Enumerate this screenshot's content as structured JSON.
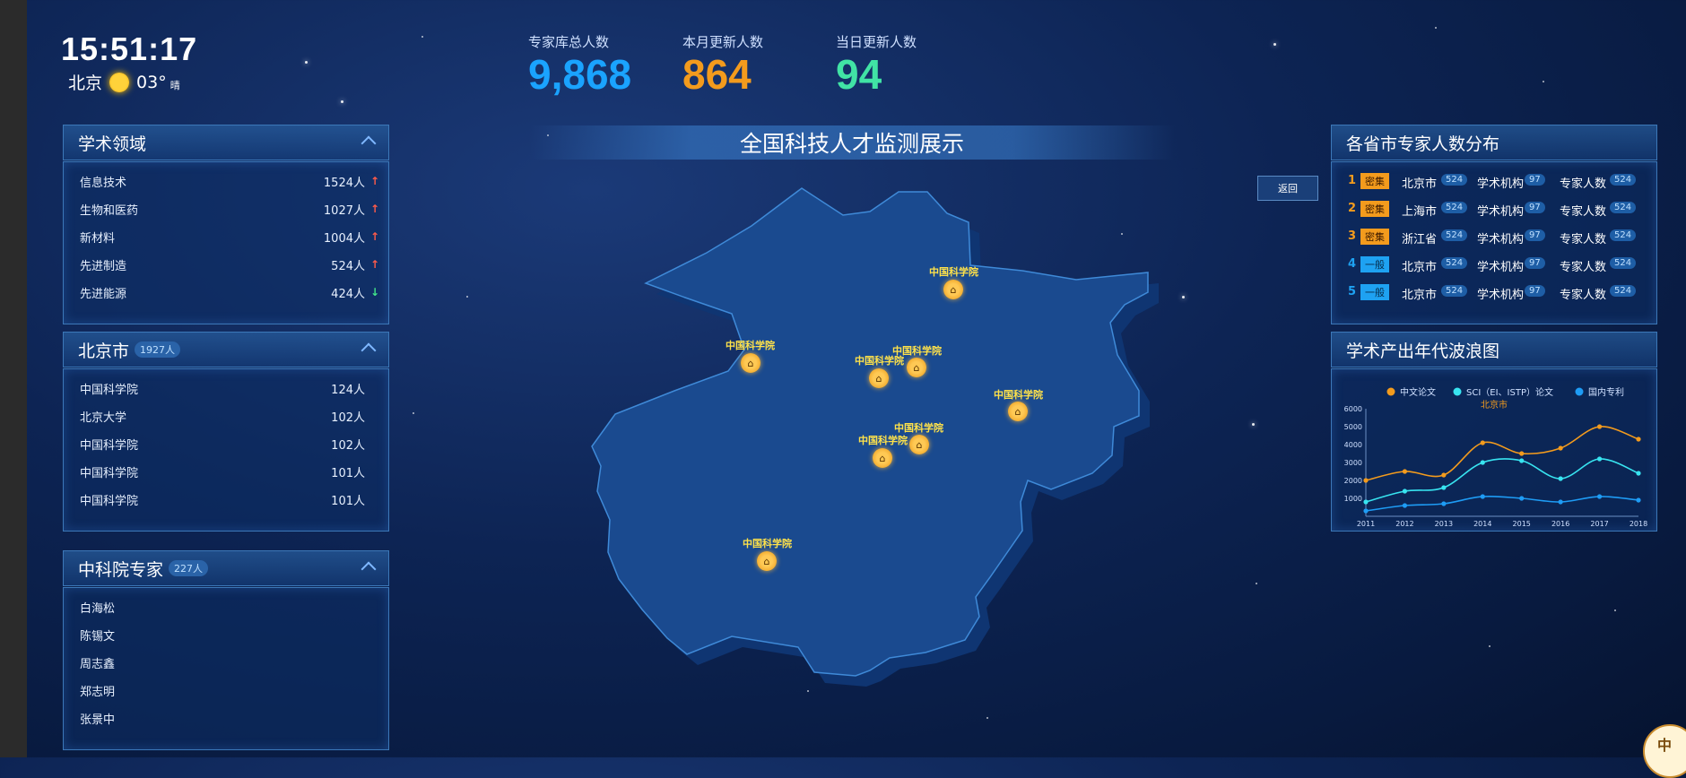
{
  "clock": "15:51:17",
  "weather": {
    "city": "北京",
    "temp": "03°",
    "cond": "晴",
    "icon": "sun-icon"
  },
  "stats": [
    {
      "label": "专家库总人数",
      "value": "9,868",
      "color": "#1aa3ff"
    },
    {
      "label": "本月更新人数",
      "value": "864",
      "color": "#f39b1d"
    },
    {
      "label": "当日更新人数",
      "value": "94",
      "color": "#41e3a5"
    }
  ],
  "fields": {
    "title": "学术领域",
    "items": [
      {
        "name": "信息技术",
        "count": "1524人",
        "trend": "up"
      },
      {
        "name": "生物和医药",
        "count": "1027人",
        "trend": "up"
      },
      {
        "name": "新材料",
        "count": "1004人",
        "trend": "up"
      },
      {
        "name": "先进制造",
        "count": "524人",
        "trend": "up"
      },
      {
        "name": "先进能源",
        "count": "424人",
        "trend": "down"
      }
    ]
  },
  "city": {
    "title": "北京市",
    "count": "1927人",
    "items": [
      {
        "name": "中国科学院",
        "count": "124人"
      },
      {
        "name": "北京大学",
        "count": "102人"
      },
      {
        "name": "中国科学院",
        "count": "102人"
      },
      {
        "name": "中国科学院",
        "count": "101人"
      },
      {
        "name": "中国科学院",
        "count": "101人"
      }
    ]
  },
  "cas": {
    "title": "中科院专家",
    "count": "227人",
    "items": [
      "白海松",
      "陈锡文",
      "周志鑫",
      "郑志明",
      "张景中"
    ]
  },
  "main_title": "全国科技人才监测展示",
  "back_label": "返回",
  "map": {
    "label": "中国科学院",
    "colors": {
      "fill": "#1a4a8f",
      "edge": "#3f8ad8",
      "side": "#0f3572"
    }
  },
  "ranking": {
    "title": "各省市专家人数分布",
    "rows": [
      {
        "rank": "1",
        "tag": "密集",
        "type": "dense",
        "city": "北京市",
        "cityNum": "524",
        "org": "学术机构",
        "orgNum": "97",
        "expert": "专家人数",
        "expertNum": "524"
      },
      {
        "rank": "2",
        "tag": "密集",
        "type": "dense",
        "city": "上海市",
        "cityNum": "524",
        "org": "学术机构",
        "orgNum": "97",
        "expert": "专家人数",
        "expertNum": "524"
      },
      {
        "rank": "3",
        "tag": "密集",
        "type": "dense",
        "city": "浙江省",
        "cityNum": "524",
        "org": "学术机构",
        "orgNum": "97",
        "expert": "专家人数",
        "expertNum": "524"
      },
      {
        "rank": "4",
        "tag": "一般",
        "type": "normal",
        "city": "北京市",
        "cityNum": "524",
        "org": "学术机构",
        "orgNum": "97",
        "expert": "专家人数",
        "expertNum": "524"
      },
      {
        "rank": "5",
        "tag": "一般",
        "type": "normal",
        "city": "北京市",
        "cityNum": "524",
        "org": "学术机构",
        "orgNum": "97",
        "expert": "专家人数",
        "expertNum": "524"
      }
    ]
  },
  "wave": {
    "title": "学术产出年代波浪图"
  },
  "chart_data": {
    "type": "line",
    "title": "北京市",
    "categories": [
      "2011",
      "2012",
      "2013",
      "2014",
      "2015",
      "2016",
      "2017",
      "2018"
    ],
    "yticks": [
      1000,
      2000,
      3000,
      4000,
      5000,
      6000
    ],
    "ylim": [
      0,
      6000
    ],
    "legend_position": "top",
    "series": [
      {
        "name": "中文论文",
        "color": "#f39b1d",
        "values": [
          2000,
          2500,
          2300,
          4100,
          3500,
          3800,
          5000,
          4300
        ]
      },
      {
        "name": "SCI（EI、ISTP）论文",
        "color": "#38e4f0",
        "values": [
          800,
          1400,
          1600,
          3000,
          3100,
          2100,
          3200,
          2400
        ]
      },
      {
        "name": "国内专利",
        "color": "#1e9cf5",
        "values": [
          300,
          600,
          700,
          1100,
          1000,
          800,
          1100,
          900
        ]
      }
    ]
  }
}
